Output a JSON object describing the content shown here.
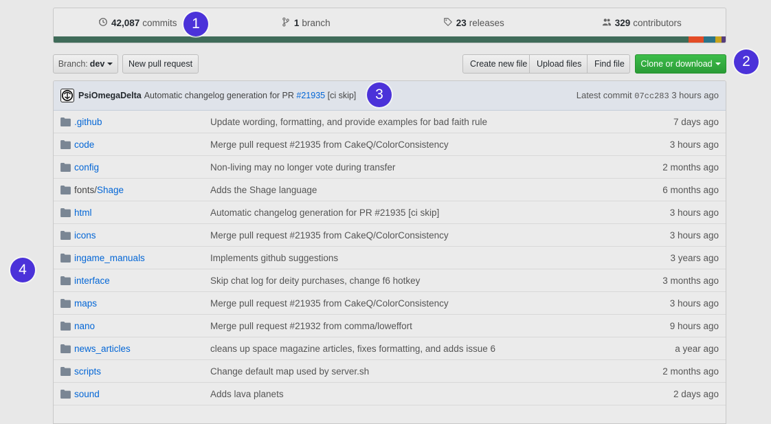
{
  "summary": {
    "commits": {
      "num": "42,087",
      "label": "commits",
      "icon": "history-icon"
    },
    "branches": {
      "num": "1",
      "label": "branch",
      "icon": "branch-icon"
    },
    "releases": {
      "num": "23",
      "label": "releases",
      "icon": "tag-icon"
    },
    "contributors": {
      "num": "329",
      "label": "contributors",
      "icon": "people-icon"
    }
  },
  "language_bar": {
    "colors": [
      "#3f6b59",
      "#e34c26",
      "#2b7489",
      "#c8a51d",
      "#563d7c"
    ],
    "fractions": [
      0.945,
      0.022,
      0.018,
      0.009,
      0.006
    ]
  },
  "toolbar": {
    "branch_prefix": "Branch:",
    "branch_name": "dev",
    "new_pull_request": "New pull request",
    "create_new_file": "Create new file",
    "upload_files": "Upload files",
    "find_file": "Find file",
    "clone_or_download": "Clone or download"
  },
  "commit_tease": {
    "author": "PsiOmegaDelta",
    "message": "Automatic changelog generation for PR",
    "pr_link": "#21935",
    "message_suffix": "[ci skip]",
    "latest_label": "Latest commit",
    "sha": "07cc283",
    "age": "3 hours ago"
  },
  "files": [
    {
      "prefix": "",
      "name": ".github",
      "message": "Update wording, formatting, and provide examples for bad faith rule",
      "age": "7 days ago"
    },
    {
      "prefix": "",
      "name": "code",
      "message": "Merge pull request #21935 from CakeQ/ColorConsistency",
      "age": "3 hours ago"
    },
    {
      "prefix": "",
      "name": "config",
      "message": "Non-living may no longer vote during transfer",
      "age": "2 months ago"
    },
    {
      "prefix": "fonts/",
      "name": "Shage",
      "message": "Adds the Shage language",
      "age": "6 months ago"
    },
    {
      "prefix": "",
      "name": "html",
      "message": "Automatic changelog generation for PR #21935 [ci skip]",
      "age": "3 hours ago"
    },
    {
      "prefix": "",
      "name": "icons",
      "message": "Merge pull request #21935 from CakeQ/ColorConsistency",
      "age": "3 hours ago"
    },
    {
      "prefix": "",
      "name": "ingame_manuals",
      "message": "Implements github suggestions",
      "age": "3 years ago"
    },
    {
      "prefix": "",
      "name": "interface",
      "message": "Skip chat log for deity purchases, change f6 hotkey",
      "age": "3 months ago"
    },
    {
      "prefix": "",
      "name": "maps",
      "message": "Merge pull request #21935 from CakeQ/ColorConsistency",
      "age": "3 hours ago"
    },
    {
      "prefix": "",
      "name": "nano",
      "message": "Merge pull request #21932 from comma/loweffort",
      "age": "9 hours ago"
    },
    {
      "prefix": "",
      "name": "news_articles",
      "message": "cleans up space magazine articles, fixes formatting, and adds issue 6",
      "age": "a year ago"
    },
    {
      "prefix": "",
      "name": "scripts",
      "message": "Change default map used by server.sh",
      "age": "2 months ago"
    },
    {
      "prefix": "",
      "name": "sound",
      "message": "Adds lava planets",
      "age": "2 days ago"
    }
  ],
  "annotations": [
    "1",
    "2",
    "3",
    "4"
  ],
  "colors": {
    "accent_badge": "#4b32d9",
    "link": "#0366d6",
    "green_button": "#2ea44f"
  }
}
